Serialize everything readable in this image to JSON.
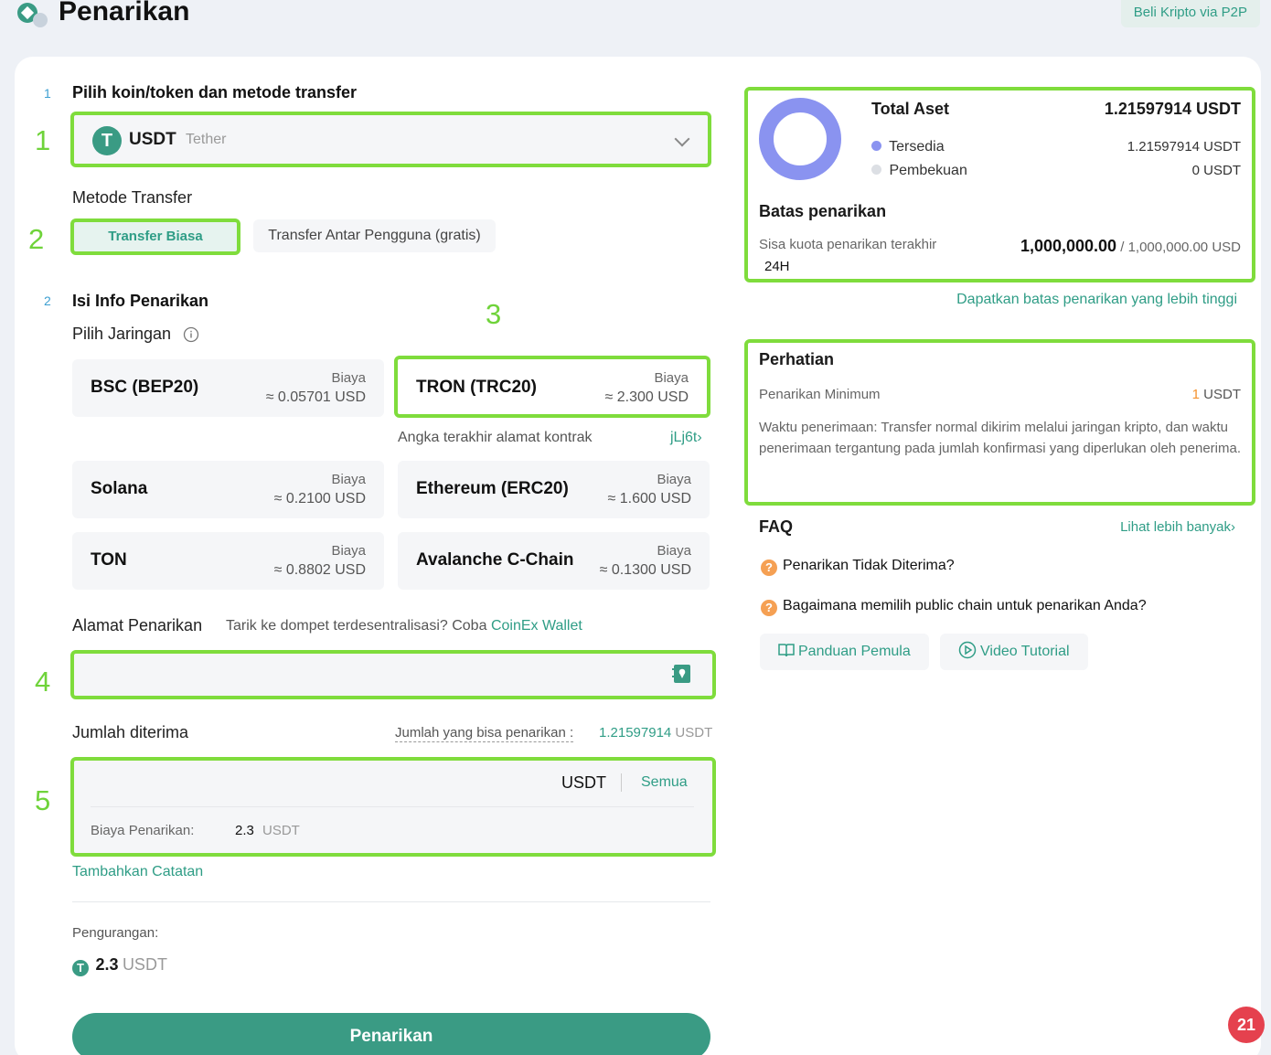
{
  "header": {
    "title": "Penarikan",
    "p2p_label": "Beli Kripto via P2P"
  },
  "annotations": [
    "1",
    "2",
    "3",
    "4",
    "5"
  ],
  "step1": {
    "number": "1",
    "title": "Pilih koin/token dan metode transfer",
    "coin_symbol": "USDT",
    "coin_name": "Tether",
    "method_label": "Metode Transfer",
    "tab_normal": "Transfer Biasa",
    "tab_internal": "Transfer Antar Pengguna (gratis)"
  },
  "step2": {
    "number": "2",
    "title": "Isi Info Penarikan",
    "network_label": "Pilih Jaringan",
    "info_icon": "info-icon",
    "networks": [
      {
        "name": "BSC (BEP20)",
        "fee_label": "Biaya",
        "fee": "≈ 0.05701 USD"
      },
      {
        "name": "TRON (TRC20)",
        "fee_label": "Biaya",
        "fee": "≈ 2.300 USD"
      },
      {
        "name": "Solana",
        "fee_label": "Biaya",
        "fee": "≈ 0.2100 USD"
      },
      {
        "name": "Ethereum (ERC20)",
        "fee_label": "Biaya",
        "fee": "≈ 1.600 USD"
      },
      {
        "name": "TON",
        "fee_label": "Biaya",
        "fee": "≈ 0.8802 USD"
      },
      {
        "name": "Avalanche C-Chain",
        "fee_label": "Biaya",
        "fee": "≈ 0.1300 USD"
      }
    ],
    "contract_label": "Angka terakhir alamat kontrak",
    "contract_value": "jLj6t",
    "address_label": "Alamat Penarikan",
    "address_hint": "Tarik ke dompet terdesentralisasi? Coba",
    "address_hint_link": "CoinEx Wallet",
    "address_value": "",
    "amount_label": "Jumlah diterima",
    "available_label": "Jumlah yang bisa penarikan :",
    "available_value": "1.21597914",
    "available_unit": "USDT",
    "amount_unit": "USDT",
    "all_label": "Semua",
    "fee_label": "Biaya Penarikan:",
    "fee_value": "2.3",
    "fee_unit": "USDT",
    "add_note": "Tambahkan Catatan",
    "deduct_label": "Pengurangan:",
    "deduct_value": "2.3",
    "deduct_unit": "USDT",
    "submit": "Penarikan"
  },
  "assets": {
    "total_label": "Total Aset",
    "total_value": "1.21597914 USDT",
    "available_label": "Tersedia",
    "available_value": "1.21597914 USDT",
    "frozen_label": "Pembekuan",
    "frozen_value": "0 USDT",
    "available_fraction": 1.0,
    "ring_color": "#8a93f0",
    "limit_title": "Batas penarikan",
    "quota_label": "Sisa kuota penarikan terakhir",
    "quota_period": "24H",
    "quota_value": "1,000,000.00",
    "quota_total": "/ 1,000,000.00 USD",
    "upgrade_link": "Dapatkan batas penarikan yang lebih tinggi"
  },
  "notice": {
    "title": "Perhatian",
    "min_label": "Penarikan Minimum",
    "min_value": "1",
    "min_unit": "USDT",
    "text": "Waktu penerimaan: Transfer normal dikirim melalui jaringan kripto, dan waktu penerimaan tergantung pada jumlah konfirmasi yang diperlukan oleh penerima."
  },
  "faq": {
    "title": "FAQ",
    "more": "Lihat lebih banyak",
    "q1": "Penarikan Tidak Diterima?",
    "q2": "Bagaimana memilih public chain untuk penarikan Anda?",
    "guide": "Panduan Pemula",
    "video": "Video Tutorial"
  },
  "badge": "21"
}
